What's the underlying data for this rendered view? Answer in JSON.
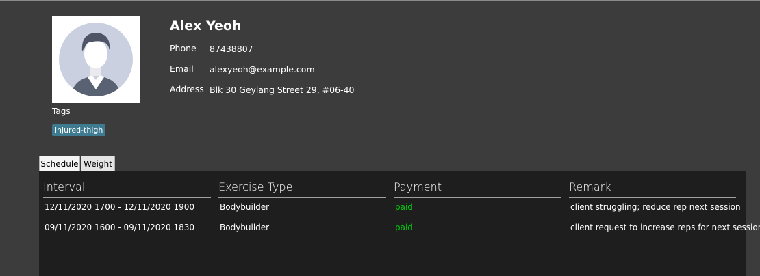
{
  "person": {
    "name": "Alex Yeoh",
    "phone_label": "Phone",
    "phone": "87438807",
    "email_label": "Email",
    "email": "alexyeoh@example.com",
    "address_label": "Address",
    "address": "Blk 30 Geylang Street 29, #06-40"
  },
  "tags": {
    "label": "Tags",
    "items": [
      "injured-thigh"
    ],
    "chip_color": "#3e7b91"
  },
  "tabs": [
    {
      "label": "Schedule",
      "active": true
    },
    {
      "label": "Weight",
      "active": false
    }
  ],
  "table": {
    "headers": [
      "Interval",
      "Exercise Type",
      "Payment",
      "Remark"
    ],
    "rows": [
      {
        "interval": "12/11/2020 1700 - 12/11/2020 1900",
        "type": "Bodybuilder",
        "payment": "paid",
        "remark": "client struggling; reduce rep next session"
      },
      {
        "interval": "09/11/2020 1600 - 09/11/2020 1830",
        "type": "Bodybuilder",
        "payment": "paid",
        "remark": "client request to increase reps for next session"
      }
    ],
    "paid_color": "#00c80a"
  },
  "icons": {
    "avatar": "default-user-avatar-icon"
  }
}
